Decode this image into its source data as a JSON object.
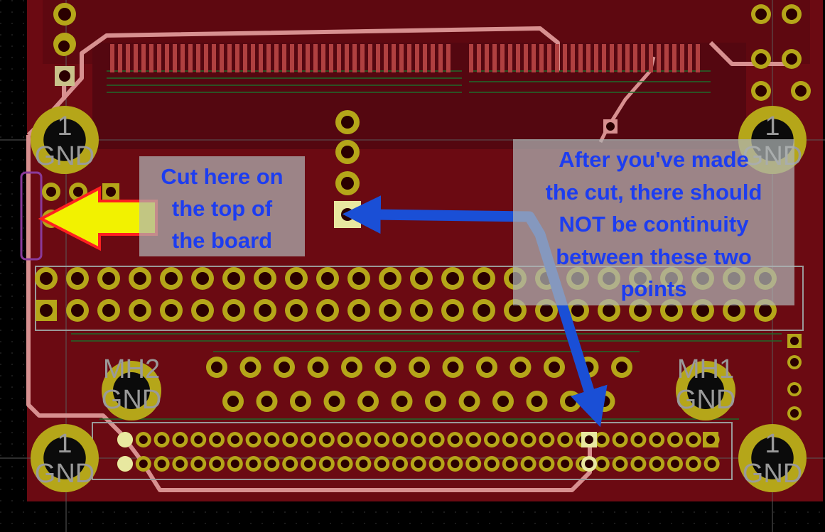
{
  "mount_label_top": "1",
  "mount_label_bottom": "GND",
  "mh2_line1": "MH2",
  "mh2_line2": "GND",
  "mh1_line1": "MH1",
  "mh1_line2": "GND",
  "left_callout": [
    "Cut here on",
    "the top of",
    "the board"
  ],
  "right_callout": [
    "After you've made",
    "the cut, there should",
    "NOT be continuity",
    "between these two",
    "points"
  ],
  "colors": {
    "board": "#6b0a12",
    "copper_pad": "#b5a619",
    "silkscreen": "#9a9a9a",
    "trace_outline": "#d89090",
    "arrow_yellow": "#f2f200",
    "arrow_blue": "#1a4fd6",
    "callout_text": "#1d3df0"
  }
}
